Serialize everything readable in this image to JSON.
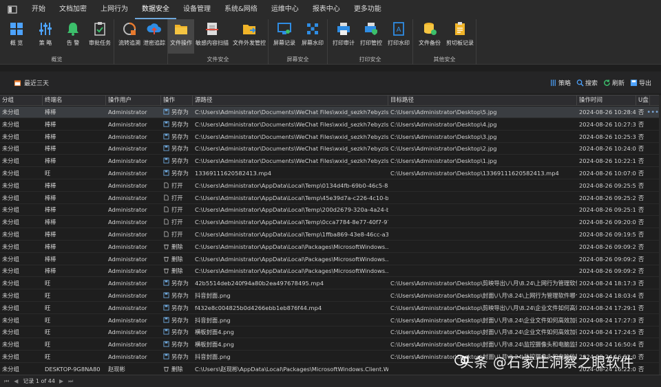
{
  "menubar": {
    "items": [
      "开始",
      "文档加密",
      "上网行为",
      "数据安全",
      "设备管理",
      "系统&网络",
      "运维中心",
      "报表中心",
      "更多功能"
    ],
    "active_index": 3
  },
  "ribbon": {
    "groups": [
      {
        "label": "概览",
        "buttons": [
          "概 览",
          "策 略",
          "告 警",
          "审批任务"
        ]
      },
      {
        "label": "",
        "buttons": [
          "流转追溯",
          "泄密追踪"
        ]
      },
      {
        "label": "文件安全",
        "buttons": [
          "文件操作",
          "敏感内容扫描",
          "文件外发管控"
        ]
      },
      {
        "label": "屏幕安全",
        "buttons": [
          "屏幕记录",
          "屏幕水印"
        ]
      },
      {
        "label": "打印安全",
        "buttons": [
          "打印审计",
          "打印管控",
          "打印水印"
        ]
      },
      {
        "label": "其他安全",
        "buttons": [
          "文件备份",
          "剪切板记录"
        ]
      }
    ],
    "selected": "文件操作"
  },
  "toolbar": {
    "range_label": "最近三天",
    "strategy": "策略",
    "search": "搜索",
    "refresh": "刷新",
    "export": "导出"
  },
  "table": {
    "headers": [
      "分组",
      "终端名",
      "操作用户",
      "操作",
      "源路径",
      "目标路径",
      "操作时间",
      "U盘"
    ],
    "rows": [
      [
        "未分组",
        "棒棒",
        "Administrator",
        "另存为",
        "C:\\Users\\Administrator\\Documents\\WeChat Files\\wxid_sezkh7ebyzls22\\...",
        "C:\\Users\\Administrator\\Desktop\\5.jpg",
        "2024-08-26 10:28:49",
        "否"
      ],
      [
        "未分组",
        "棒棒",
        "Administrator",
        "另存为",
        "C:\\Users\\Administrator\\Documents\\WeChat Files\\wxid_sezkh7ebyzls22\\...",
        "C:\\Users\\Administrator\\Desktop\\4.jpg",
        "2024-08-26 10:27:32",
        "否"
      ],
      [
        "未分组",
        "棒棒",
        "Administrator",
        "另存为",
        "C:\\Users\\Administrator\\Documents\\WeChat Files\\wxid_sezkh7ebyzls22\\...",
        "C:\\Users\\Administrator\\Desktop\\3.jpg",
        "2024-08-26 10:25:36",
        "否"
      ],
      [
        "未分组",
        "棒棒",
        "Administrator",
        "另存为",
        "C:\\Users\\Administrator\\Documents\\WeChat Files\\wxid_sezkh7ebyzls22\\...",
        "C:\\Users\\Administrator\\Desktop\\2.jpg",
        "2024-08-26 10:24:06",
        "否"
      ],
      [
        "未分组",
        "棒棒",
        "Administrator",
        "另存为",
        "C:\\Users\\Administrator\\Documents\\WeChat Files\\wxid_sezkh7ebyzls22\\...",
        "C:\\Users\\Administrator\\Desktop\\1.jpg",
        "2024-08-26 10:22:10",
        "否"
      ],
      [
        "未分组",
        "旺",
        "Administrator",
        "另存为",
        "13369111620582413.mp4",
        "C:\\Users\\Administrator\\Desktop\\13369111620582413.mp4",
        "2024-08-26 10:07:03",
        "否"
      ],
      [
        "未分组",
        "棒棒",
        "Administrator",
        "打开",
        "C:\\Users\\Administrator\\AppData\\Local\\Temp\\0134d4fb-69b0-46c5-8a9...",
        "",
        "2024-08-26 09:25:57",
        "否"
      ],
      [
        "未分组",
        "棒棒",
        "Administrator",
        "打开",
        "C:\\Users\\Administrator\\AppData\\Local\\Temp\\45e39d7a-c226-4c10-bb...",
        "",
        "2024-08-26 09:25:29",
        "否"
      ],
      [
        "未分组",
        "棒棒",
        "Administrator",
        "打开",
        "C:\\Users\\Administrator\\AppData\\Local\\Temp\\200d2679-320a-4a24-b1...",
        "",
        "2024-08-26 09:25:18",
        "否"
      ],
      [
        "未分组",
        "棒棒",
        "Administrator",
        "打开",
        "C:\\Users\\Administrator\\AppData\\Local\\Temp\\0cca7784-8e77-40f7-976...",
        "",
        "2024-08-26 09:20:05",
        "否"
      ],
      [
        "未分组",
        "棒棒",
        "Administrator",
        "打开",
        "C:\\Users\\Administrator\\AppData\\Local\\Temp\\1ffba869-43e8-46cc-a3e2...",
        "",
        "2024-08-26 09:19:53",
        "否"
      ],
      [
        "未分组",
        "棒棒",
        "Administrator",
        "删除",
        "C:\\Users\\Administrator\\AppData\\Local\\Packages\\MicrosoftWindows....",
        "",
        "2024-08-26 09:09:22",
        "否"
      ],
      [
        "未分组",
        "棒棒",
        "Administrator",
        "删除",
        "C:\\Users\\Administrator\\AppData\\Local\\Packages\\MicrosoftWindows....",
        "",
        "2024-08-26 09:09:22",
        "否"
      ],
      [
        "未分组",
        "棒棒",
        "Administrator",
        "删除",
        "C:\\Users\\Administrator\\AppData\\Local\\Packages\\MicrosoftWindows....",
        "",
        "2024-08-26 09:09:22",
        "否"
      ],
      [
        "未分组",
        "旺",
        "Administrator",
        "另存为",
        "42b5514deb240f94a80b2ea497678495.mp4",
        "C:\\Users\\Administrator\\Desktop\\剪映导出\\八月\\8.24\\上网行为管理软件...",
        "2024-08-24 18:17:32",
        "否"
      ],
      [
        "未分组",
        "旺",
        "Administrator",
        "另存为",
        "抖音封面.png",
        "C:\\Users\\Administrator\\Desktop\\封面\\八月\\8.24\\上网行为管理软件哪个...",
        "2024-08-24 18:03:42",
        "否"
      ],
      [
        "未分组",
        "旺",
        "Administrator",
        "另存为",
        "f432e8c004825b0d4266ebb1eb876f44.mp4",
        "C:\\Users\\Administrator\\Desktop\\剪映导出\\八月\\8.24\\企业文件如何高效...",
        "2024-08-24 17:29:12",
        "否"
      ],
      [
        "未分组",
        "旺",
        "Administrator",
        "另存为",
        "抖音封面.png",
        "C:\\Users\\Administrator\\Desktop\\封面\\八月\\8.24\\企业文件如何高效加密...",
        "2024-08-24 17:27:39",
        "否"
      ],
      [
        "未分组",
        "旺",
        "Administrator",
        "另存为",
        "横板封面4.png",
        "C:\\Users\\Administrator\\Desktop\\封面\\八月\\8.24\\企业文件如何高效加密...",
        "2024-08-24 17:24:53",
        "否"
      ],
      [
        "未分组",
        "旺",
        "Administrator",
        "另存为",
        "横板封面4.png",
        "C:\\Users\\Administrator\\Desktop\\封面\\八月\\8.24\\监控摄像头和电脑监控...",
        "2024-08-24 16:50:44",
        "否"
      ],
      [
        "未分组",
        "旺",
        "Administrator",
        "另存为",
        "抖音封面.png",
        "C:\\Users\\Administrator\\Desktop\\封面\\八月\\8.24\\监控摄像头和电脑监控...",
        "2024-08-24 16:32:00",
        "否"
      ],
      [
        "未分组",
        "DESKTOP-9G8NA80",
        "赵现彬",
        "删除",
        "C:\\Users\\赵现彬\\AppData\\Local\\Packages\\MicrosoftWindows.Client.We...",
        "",
        "2024-08-24 16:22:01",
        "否"
      ]
    ]
  },
  "footer": {
    "record_label": "记录 1 of 44"
  },
  "watermark": "头条 @石家庄洞察之眼软件",
  "colors": {
    "background": "#1e1e1e",
    "ribbon": "#2b2b2b",
    "selected_row": "#3a3d41",
    "accent": "#6fa8dc"
  }
}
